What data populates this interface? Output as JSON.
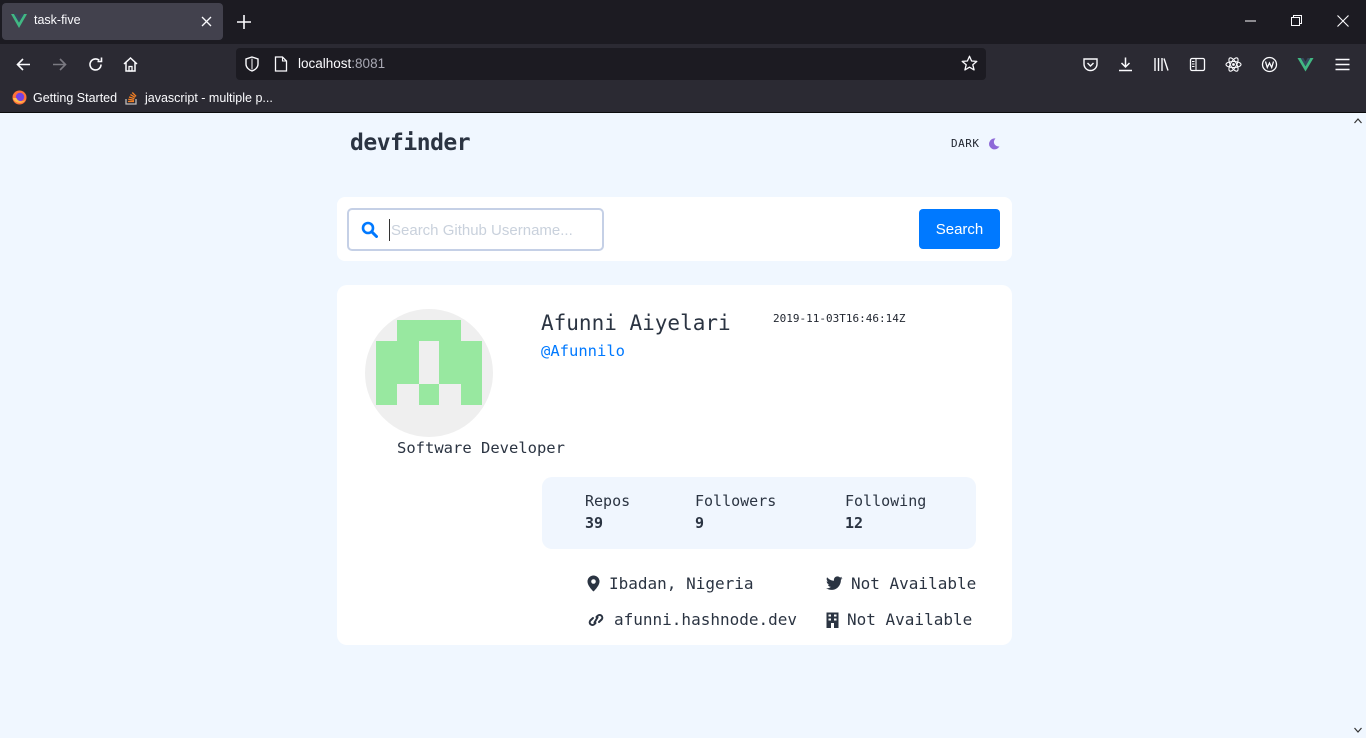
{
  "browser": {
    "tab_title": "task-five",
    "url_host": "localhost",
    "url_port": ":8081",
    "bookmarks": [
      {
        "label": "Getting Started",
        "icon": "firefox-icon"
      },
      {
        "label": "javascript - multiple p...",
        "icon": "stackoverflow-icon"
      }
    ]
  },
  "app": {
    "logo": "devfinder",
    "theme_label": "DARK",
    "search": {
      "placeholder": "Search Github Username...",
      "button_label": "Search"
    },
    "profile": {
      "name": "Afunni Aiyelari",
      "username": "@Afunnilo",
      "joined": "2019-11-03T16:46:14Z",
      "bio": "Software Developer",
      "stats": {
        "repos_label": "Repos",
        "repos": "39",
        "followers_label": "Followers",
        "followers": "9",
        "following_label": "Following",
        "following": "12"
      },
      "location": "Ibadan, Nigeria",
      "twitter": "Not Available",
      "blog": "afunni.hashnode.dev",
      "company": "Not Available"
    }
  },
  "colors": {
    "accent": "#0079ff",
    "page_bg": "#f0f7ff",
    "avatar_green": "#98e8a0"
  }
}
